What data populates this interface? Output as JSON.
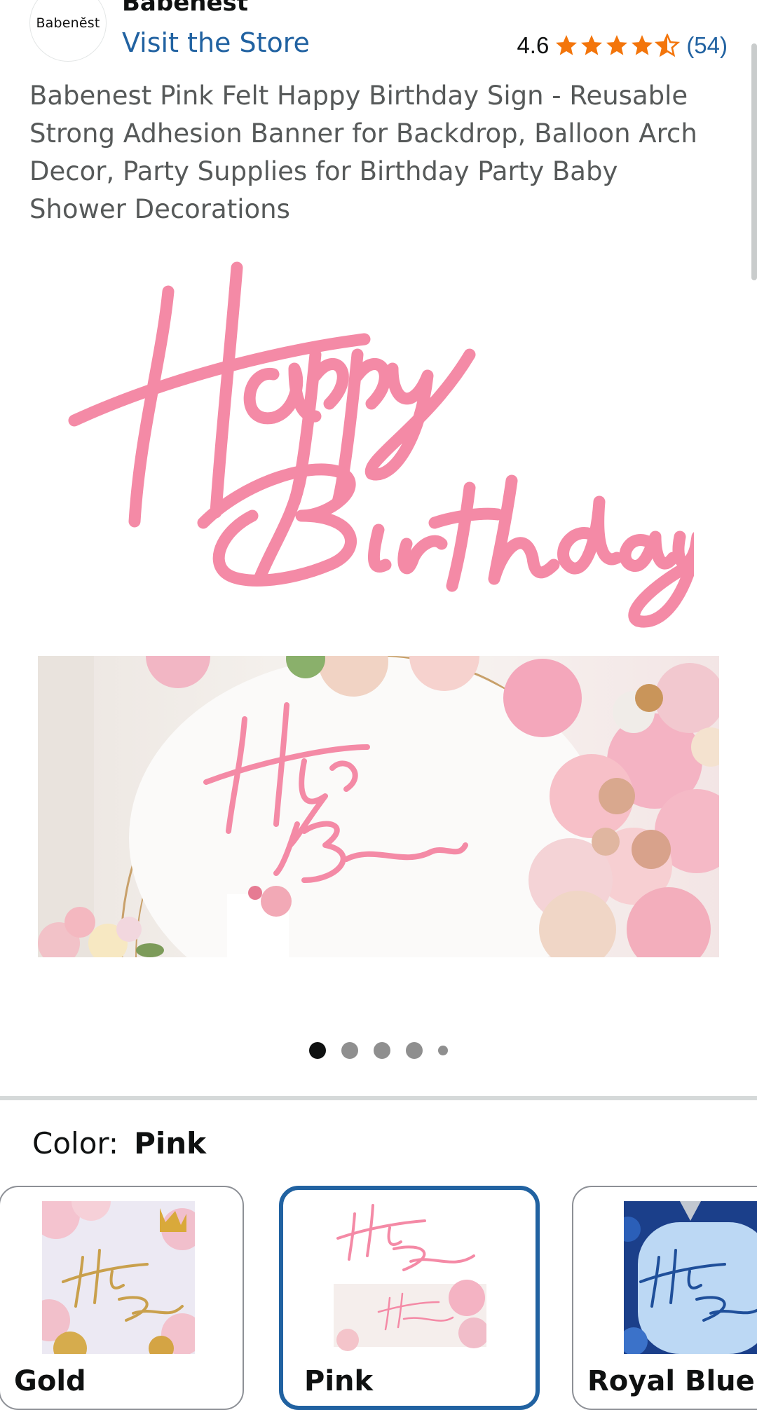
{
  "store": {
    "logo_text": "Babenĕst",
    "brand_name": "Babenest",
    "visit_link": "Visit the Store"
  },
  "rating": {
    "value": "4.6",
    "stars": 4.6,
    "count": "(54)",
    "star_color": "#f3750b"
  },
  "product": {
    "title": "Babenest Pink Felt Happy Birthday Sign - Reusable Strong Adhesion Banner for Backdrop, Balloon Arch Decor, Party Supplies for Birthday Party Baby Shower Decorations"
  },
  "gallery": {
    "hero_sign_text": [
      "Happy",
      "Birthday"
    ],
    "sign_color": "#f48aa6",
    "dots": [
      {
        "state": "active"
      },
      {
        "state": "inactive"
      },
      {
        "state": "inactive"
      },
      {
        "state": "inactive"
      },
      {
        "state": "small"
      }
    ]
  },
  "variation": {
    "label": "Color:",
    "selected_value": "Pink",
    "swatches": [
      {
        "name": "Gold",
        "sign_color": "#c9a04c",
        "selected": false
      },
      {
        "name": "Pink",
        "sign_color": "#f48aa6",
        "selected": true
      },
      {
        "name": "Royal Blue",
        "sign_color": "#1f4f9a",
        "selected": false
      }
    ]
  },
  "colors": {
    "link": "#2162a1",
    "selected_border": "#2162a1",
    "text_secondary": "#565959"
  }
}
